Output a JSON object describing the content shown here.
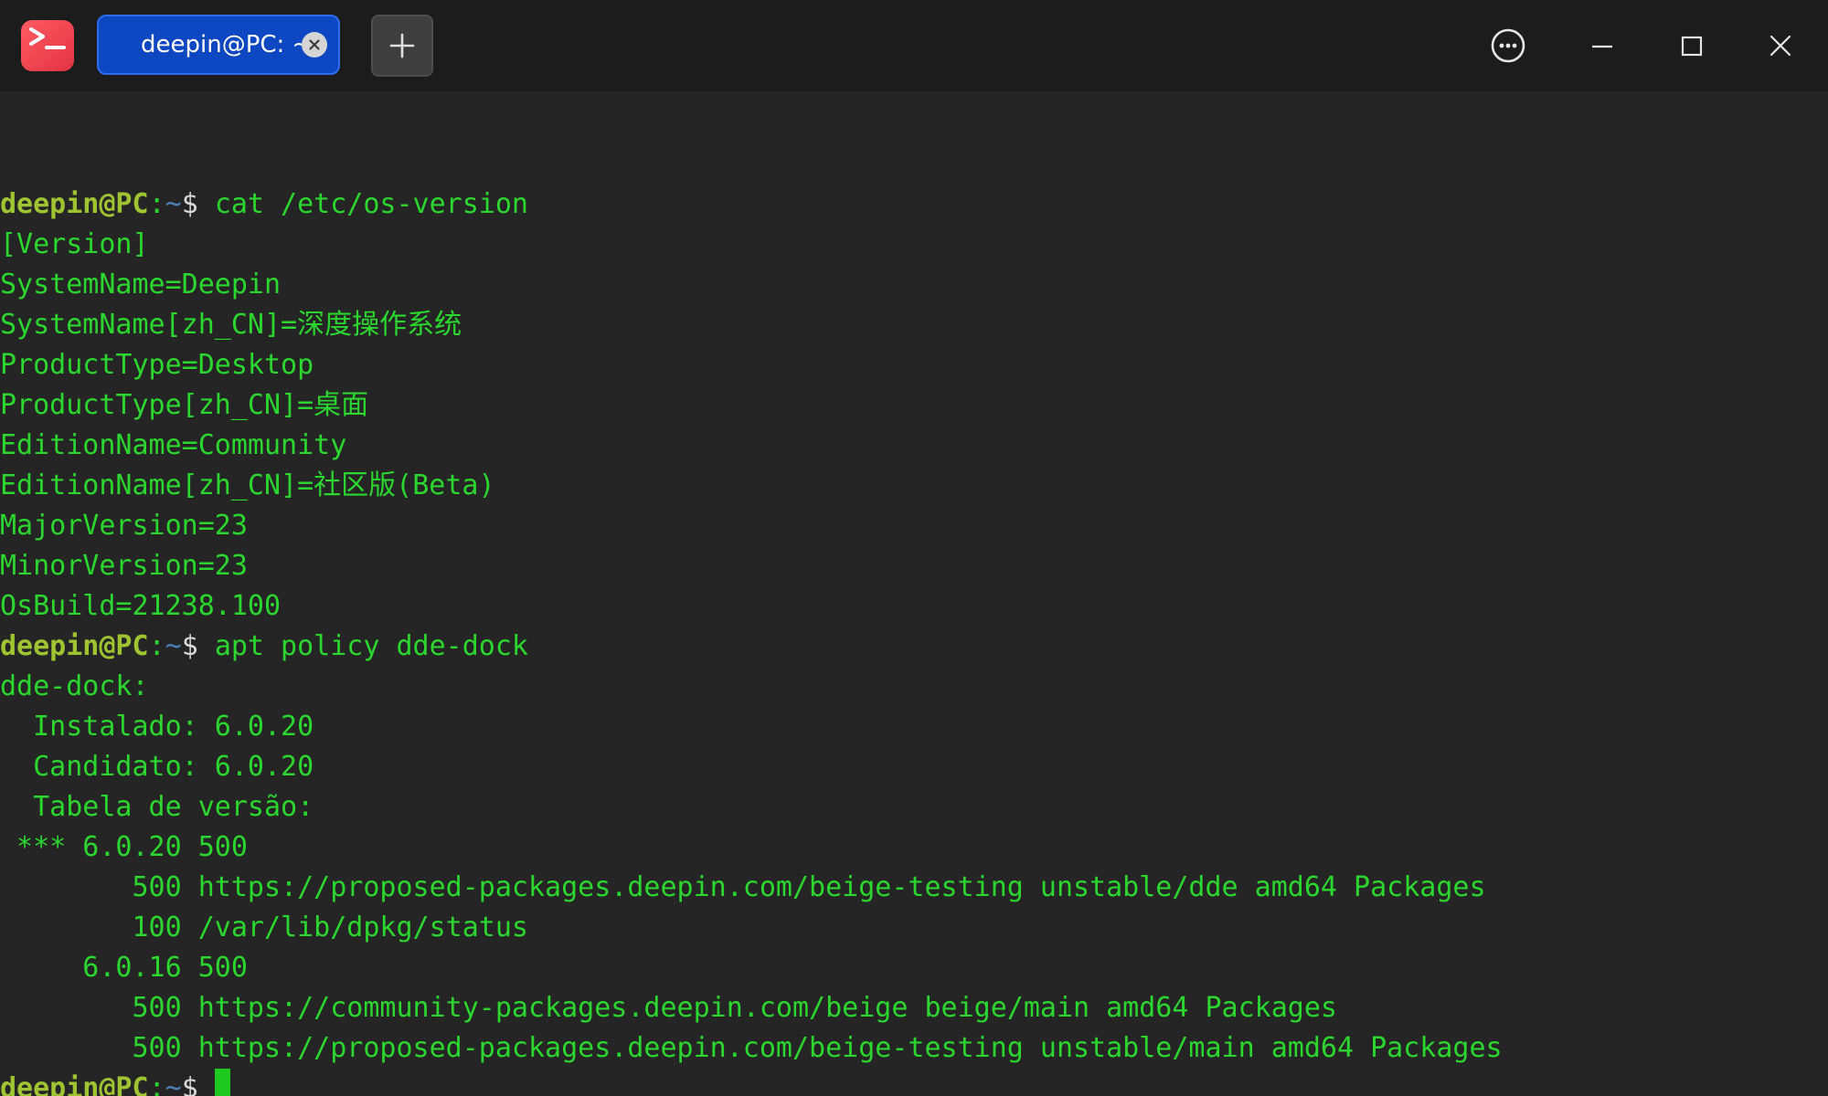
{
  "window": {
    "tab_title": "deepin@PC: ~",
    "accent": "#0d47c2",
    "app_icon_color": "#e23343"
  },
  "icons": {
    "app": "terminal-app-icon",
    "tab_close": "close-circle-icon",
    "new_tab": "plus-icon",
    "menu": "more-options-icon",
    "minimize": "minimize-icon",
    "maximize": "maximize-icon",
    "close": "close-icon"
  },
  "terminal": {
    "colors": {
      "output": "#2bd62e",
      "prompt_user": "#9fc431",
      "prompt_path": "#4a7fb8",
      "cursor": "#1ec81e"
    },
    "prompt": {
      "user": "deepin@PC",
      "colon": ":",
      "path": "~",
      "dollar": "$ "
    },
    "commands": [
      "cat /etc/os-version",
      "apt policy dde-dock"
    ],
    "output1": [
      "[Version]",
      "SystemName=Deepin",
      "SystemName[zh_CN]=深度操作系统",
      "ProductType=Desktop",
      "ProductType[zh_CN]=桌面",
      "EditionName=Community",
      "EditionName[zh_CN]=社区版(Beta)",
      "MajorVersion=23",
      "MinorVersion=23",
      "OsBuild=21238.100"
    ],
    "output2": [
      "dde-dock:",
      "  Instalado: 6.0.20",
      "  Candidato: 6.0.20",
      "  Tabela de versão:",
      " *** 6.0.20 500",
      "        500 https://proposed-packages.deepin.com/beige-testing unstable/dde amd64 Packages",
      "        100 /var/lib/dpkg/status",
      "     6.0.16 500",
      "        500 https://community-packages.deepin.com/beige beige/main amd64 Packages",
      "        500 https://proposed-packages.deepin.com/beige-testing unstable/main amd64 Packages"
    ]
  }
}
